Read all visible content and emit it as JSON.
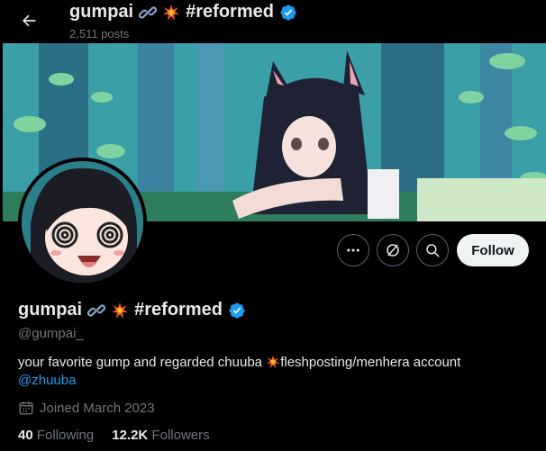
{
  "header": {
    "display_name": "gumpai",
    "tag": "#reformed",
    "post_count": "2,511 posts"
  },
  "profile": {
    "display_name": "gumpai",
    "tag": "#reformed",
    "handle": "@gumpai_",
    "bio_text": "your favorite gump and regarded chuuba",
    "bio_text_2": "fleshposting/menhera account",
    "bio_mention": "@zhuuba",
    "joined": "Joined March 2023",
    "following_count": "40",
    "following_label": "Following",
    "followers_count": "12.2K",
    "followers_label": "Followers"
  },
  "actions": {
    "follow_label": "Follow",
    "more_icon": "more-icon",
    "grok_icon": "slash-circle-icon",
    "search_icon": "search-icon"
  },
  "colors": {
    "accent": "#1d9bf0",
    "verified": "#1d9bf0",
    "muted": "#71767b",
    "border": "#536471"
  }
}
